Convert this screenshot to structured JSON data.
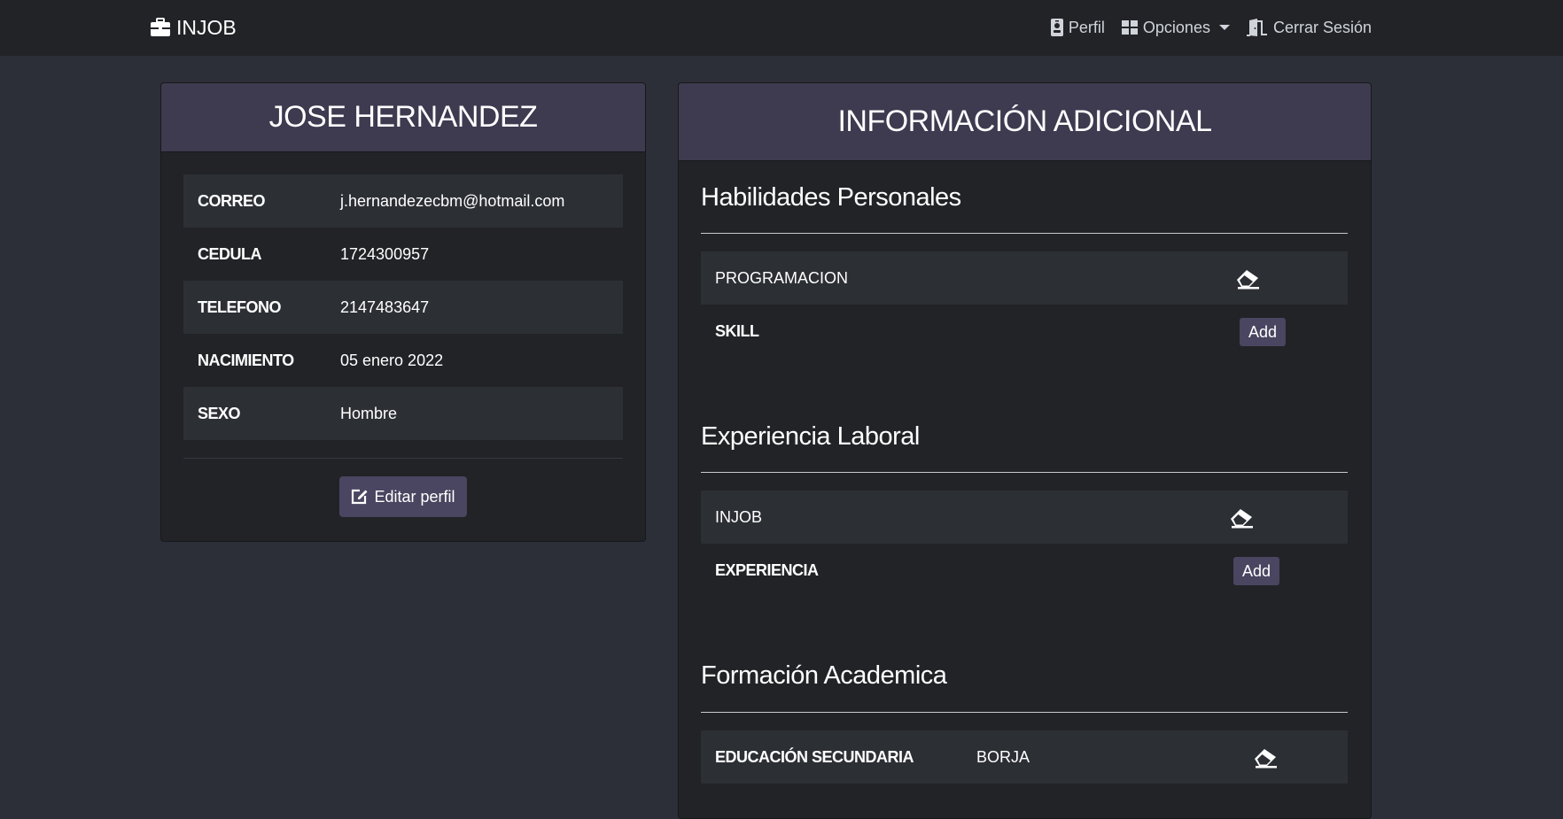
{
  "navbar": {
    "brand": "INJOB",
    "links": {
      "profile": "Perfil",
      "options": "Opciones",
      "logout": "Cerrar Sesión"
    }
  },
  "profile": {
    "name": "JOSE HERNANDEZ",
    "fields": [
      {
        "label": "CORREO",
        "value": "j.hernandezecbm@hotmail.com"
      },
      {
        "label": "CEDULA",
        "value": "1724300957"
      },
      {
        "label": "TELEFONO",
        "value": "2147483647"
      },
      {
        "label": "NACIMIENTO",
        "value": "05 enero 2022"
      },
      {
        "label": "SEXO",
        "value": "Hombre"
      }
    ],
    "edit_label": "Editar perfil"
  },
  "additional": {
    "title": "INFORMACIÓN ADICIONAL",
    "skills": {
      "title": "Habilidades Personales",
      "items": [
        "PROGRAMACION"
      ],
      "add_row_label": "SKILL",
      "add_label": "Add"
    },
    "experience": {
      "title": "Experiencia Laboral",
      "items": [
        "INJOB"
      ],
      "add_row_label": "EXPERIENCIA",
      "add_label": "Add"
    },
    "education": {
      "title": "Formación Academica",
      "items": [
        {
          "level": "EDUCACIÓN SECUNDARIA",
          "institution": "BORJA"
        }
      ]
    }
  },
  "icons": {
    "brand": "briefcase-icon",
    "profile": "id-badge-icon",
    "options": "grid-icon",
    "logout": "door-exit-icon",
    "edit": "edit-icon",
    "delete": "eraser-icon"
  },
  "colors": {
    "page_bg": "#2c2f37",
    "navbar_bg": "#212327",
    "card_bg": "#212327",
    "card_header_bg": "#3e3a50",
    "button_bg": "#4a4560",
    "row_stripe": "#2c2f34"
  }
}
